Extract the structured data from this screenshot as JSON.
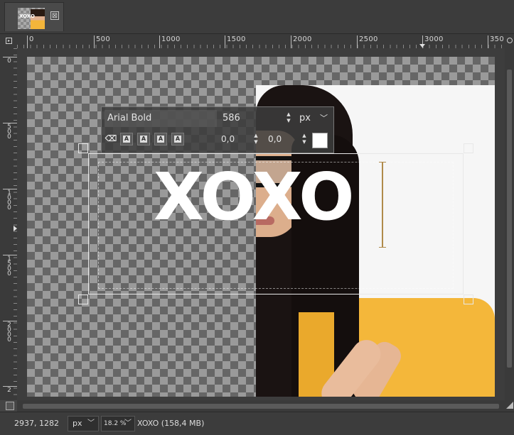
{
  "tab": {
    "thumbnail_text": "XOXO",
    "close_glyph": "⊠"
  },
  "ruler": {
    "h_labels": [
      "0",
      "500",
      "1000",
      "1500",
      "2000",
      "2500",
      "3000",
      "350"
    ],
    "v_labels": [
      "0",
      "500",
      "1000",
      "1500",
      "2000",
      "2"
    ]
  },
  "text_toolbar": {
    "font": "Arial Bold",
    "size": "586",
    "unit": "px",
    "baseline": "0,0",
    "kerning": "0,0",
    "color": "#ffffff",
    "format_buttons": [
      {
        "name": "clear-style-button",
        "glyph": "⌫"
      },
      {
        "name": "bold-button",
        "glyph": "A"
      },
      {
        "name": "italic-button",
        "glyph": "A"
      },
      {
        "name": "underline-button",
        "glyph": "A"
      },
      {
        "name": "strikethrough-button",
        "glyph": "A"
      }
    ]
  },
  "canvas": {
    "text": "XOXO"
  },
  "status": {
    "coords": "2937, 1282",
    "unit": "px",
    "zoom": "18.2 %",
    "info": "XOXO (158,4 MB)"
  },
  "icons": {
    "tab_close": "close-icon",
    "dropdown": "chevron-down-icon",
    "spinner": "spinner-arrows-icon",
    "zoom_corner": "zoom-icon"
  },
  "colors": {
    "jacket": "#f4b73a",
    "text": "#ffffff",
    "ui_bg": "#454545"
  }
}
